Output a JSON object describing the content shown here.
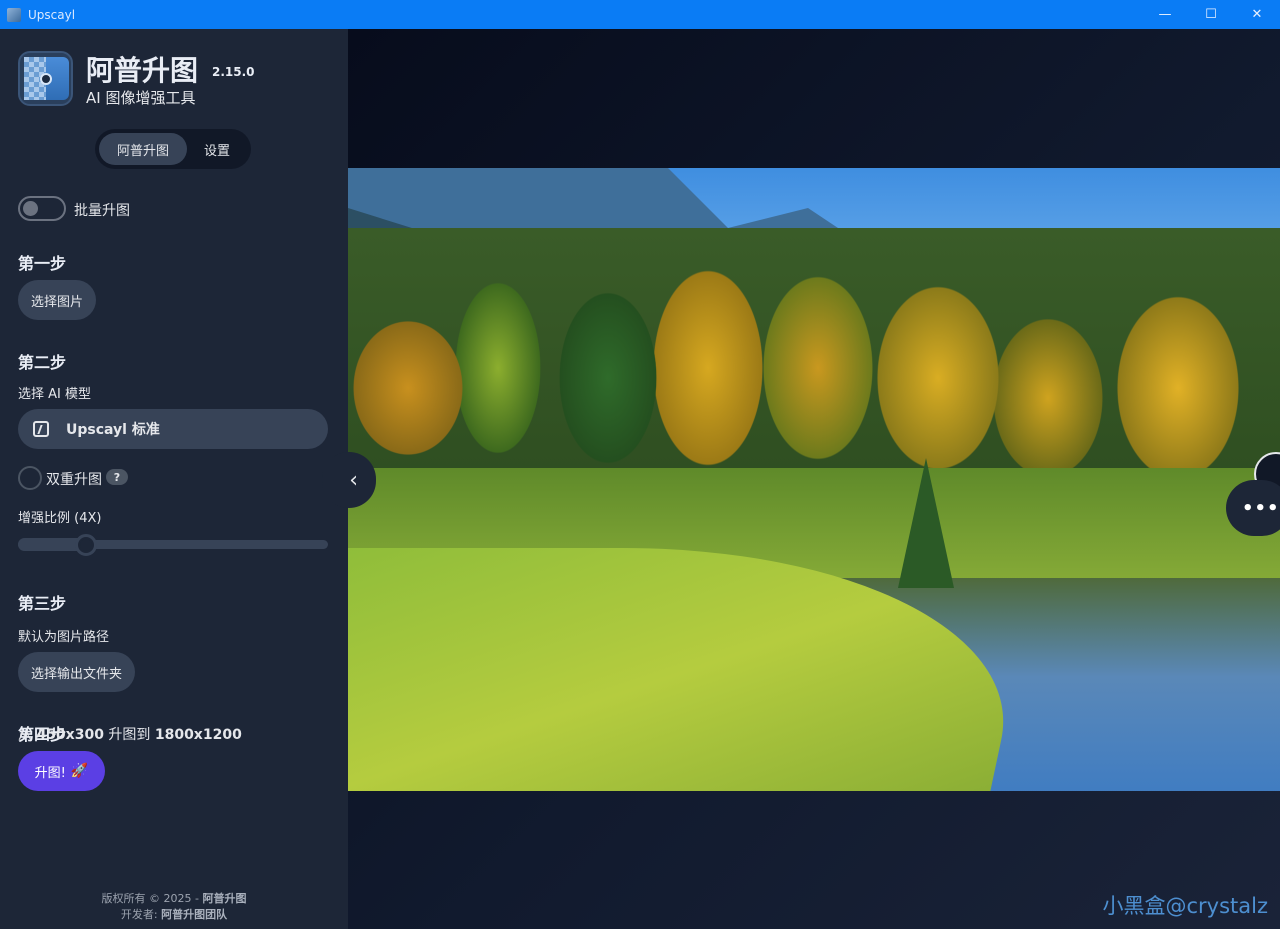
{
  "window": {
    "title": "Upscayl",
    "minimize": "—",
    "maximize": "☐",
    "close": "✕"
  },
  "app": {
    "name": "阿普升图",
    "version": "2.15.0",
    "subtitle": "AI 图像增强工具"
  },
  "tabs": [
    {
      "label": "阿普升图",
      "active": true
    },
    {
      "label": "设置",
      "active": false
    }
  ],
  "batch": {
    "label": "批量升图",
    "enabled": false
  },
  "step1": {
    "title": "第一步",
    "button": "选择图片"
  },
  "step2": {
    "title": "第二步",
    "model_label": "选择 AI 模型",
    "model_value": "Upscayl 标准",
    "double_label": "双重升图",
    "double_checked": false,
    "help": "?",
    "scale_label": "增强比例 (4X)",
    "scale_fraction": 0.22
  },
  "step3": {
    "title": "第三步",
    "path_label": "默认为图片路径",
    "button": "选择输出文件夹"
  },
  "step4": {
    "title": "第四步",
    "from_prefix": "从",
    "from_size": "450x300",
    "mid": "升图到",
    "to_size": "1800x1200",
    "button": "升图!",
    "button_icon": "rocket-icon"
  },
  "footer": {
    "copyright_prefix": "版权所有 © 2025 -",
    "copyright_name": "阿普升图",
    "dev_prefix": "开发者:",
    "dev_name": "阿普升图团队"
  },
  "viewer": {
    "collapse_icon": "‹",
    "more_icon": "•••"
  },
  "watermark": "小黑盒@crystalz",
  "colors": {
    "titlebar": "#0a7cf5",
    "sidebar": "#1d2637",
    "accent": "#5b3fe4"
  }
}
